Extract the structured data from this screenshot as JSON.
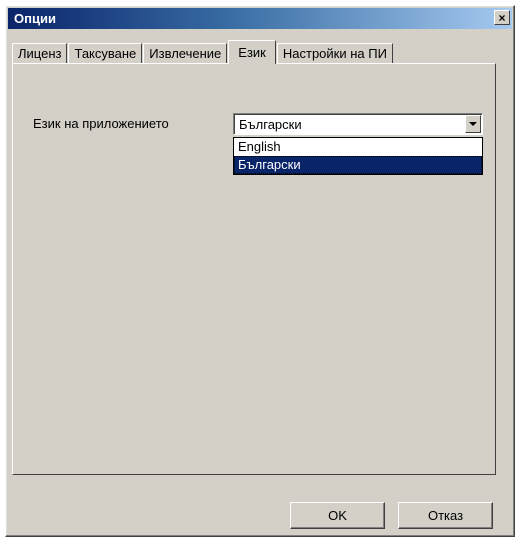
{
  "window": {
    "title": "Опции",
    "close_label": "×"
  },
  "tabs": [
    {
      "label": "Лиценз",
      "active": false
    },
    {
      "label": "Таксуване",
      "active": false
    },
    {
      "label": "Извлечение",
      "active": false
    },
    {
      "label": "Език",
      "active": true
    },
    {
      "label": "Настройки на ПИ",
      "active": false
    }
  ],
  "language": {
    "label": "Език на приложението",
    "selected_value": "Български",
    "options": [
      {
        "label": "English",
        "selected": false
      },
      {
        "label": "Български",
        "selected": true
      }
    ]
  },
  "buttons": {
    "ok_label": "OK",
    "cancel_label": "Отказ"
  },
  "colors": {
    "dialog_face": "#d4d0c8",
    "title_bar": "#0a246a",
    "selection": "#0a246a"
  }
}
